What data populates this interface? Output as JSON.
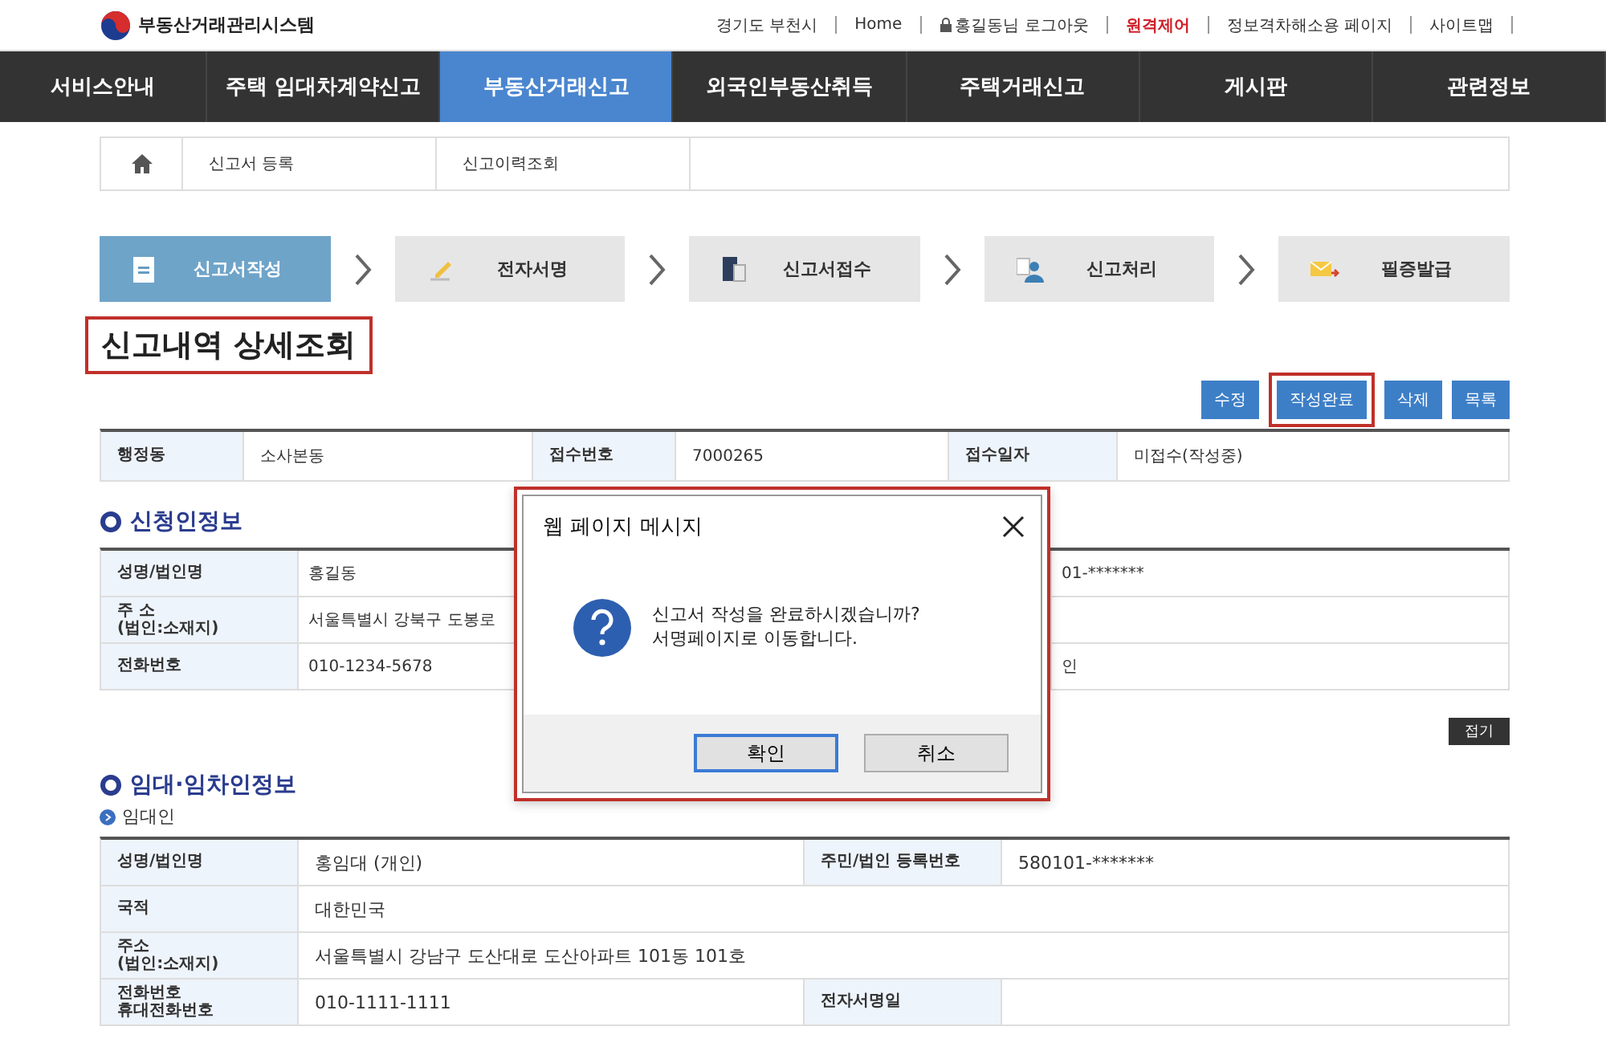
{
  "site": {
    "logo_text": "부동산거래관리시스템",
    "top_links": [
      {
        "label": "경기도 부천시",
        "kind": "text",
        "emphasized": false
      },
      {
        "label": "Home",
        "kind": "link",
        "emphasized": false
      },
      {
        "label": "홍길동님 로그아웃",
        "kind": "lock",
        "emphasized": false
      },
      {
        "label": "원격제어",
        "kind": "link",
        "emphasized": true
      },
      {
        "label": "정보격차해소용 페이지",
        "kind": "link",
        "emphasized": false
      },
      {
        "label": "사이트맵",
        "kind": "link",
        "emphasized": false
      }
    ]
  },
  "nav": [
    {
      "label": "서비스안내",
      "selected": false
    },
    {
      "label": "주택 임대차계약신고",
      "selected": false
    },
    {
      "label": "부동산거래신고",
      "selected": true
    },
    {
      "label": "외국인부동산취득",
      "selected": false
    },
    {
      "label": "주택거래신고",
      "selected": false
    },
    {
      "label": "게시판",
      "selected": false
    },
    {
      "label": "관련정보",
      "selected": false
    }
  ],
  "breadcrumb": [
    "신고서 등록",
    "신고이력조회"
  ],
  "steps": [
    {
      "label": "신고서작성",
      "kind": "document",
      "selected": true
    },
    {
      "label": "전자서명",
      "kind": "pen",
      "selected": false
    },
    {
      "label": "신고서접수",
      "kind": "files",
      "selected": false
    },
    {
      "label": "신고처리",
      "kind": "person",
      "selected": false
    },
    {
      "label": "필증발급",
      "kind": "envelope",
      "selected": false
    }
  ],
  "page_title": "신고내역 상세조회",
  "actions": [
    {
      "label": "수정",
      "highlighted": false
    },
    {
      "label": "작성완료",
      "highlighted": true
    },
    {
      "label": "삭제",
      "highlighted": false
    },
    {
      "label": "목록",
      "highlighted": false
    }
  ],
  "summary": [
    {
      "label": "행정동",
      "value": "소사본동"
    },
    {
      "label": "접수번호",
      "value": "7000265"
    },
    {
      "label": "접수일자",
      "value": "미접수(작성중)"
    }
  ],
  "applicant": {
    "title": "신청인정보",
    "rows": [
      {
        "label": "성명/법인명",
        "value": "홍길동",
        "value_2": "01-*******"
      },
      {
        "label": "주    소\n(법인:소재지)",
        "value": "서울특별시 강북구 도봉로"
      },
      {
        "label": "전화번호",
        "value": "010-1234-5678",
        "value_2": "인"
      }
    ]
  },
  "collapse_button": "접기",
  "parties": {
    "title": "임대·임차인정보",
    "subtitle": "임대인",
    "rows": [
      {
        "label": "성명/법인명",
        "value": "홍임대 (개인)",
        "label_2": "주민/법인 등록번호",
        "value_2": "580101-*******"
      },
      {
        "label": "국적",
        "value": "대한민국"
      },
      {
        "label": "주소\n(법인:소재지)",
        "value": "서울특별시 강남구 도산대로 도산아파트 101동 101호"
      },
      {
        "label": "전화번호\n휴대전화번호",
        "value": "010-1111-1111",
        "label_2": "전자서명일"
      }
    ]
  },
  "dialog": {
    "title": "웹 페이지 메시지",
    "highlighted": true,
    "message": "신고서 작성을 완료하시겠습니까?\n서명페이지로 이동합니다.",
    "buttons": [
      {
        "label": "확인",
        "focused": true
      },
      {
        "label": "취소",
        "focused": false
      }
    ]
  }
}
